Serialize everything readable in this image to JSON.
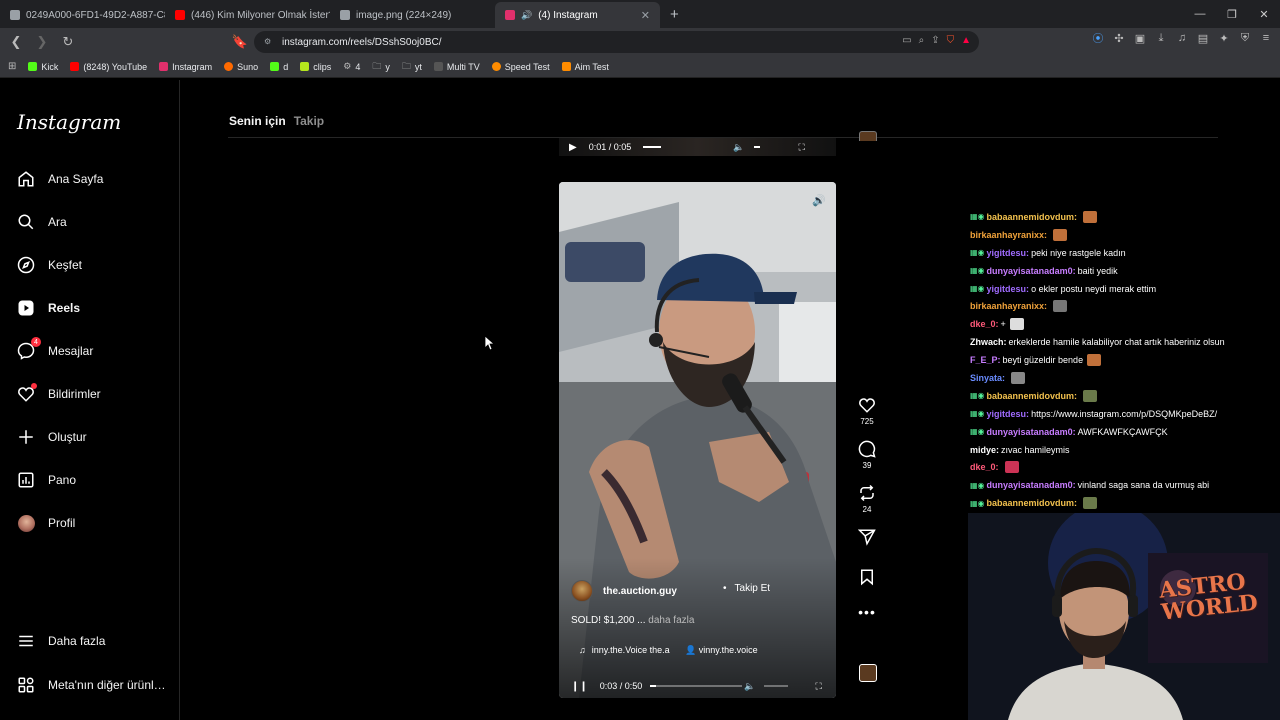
{
  "browser": {
    "tabs": [
      {
        "title": "0249A000-6FD1-49D2-A887-C83D2…",
        "favicon_color": "#9aa0a6",
        "active": false
      },
      {
        "title": "(446) Kim Milyoner Olmak İster? 120…",
        "favicon_color": "#ff0000",
        "active": false
      },
      {
        "title": "image.png (224×249)",
        "favicon_color": "#9aa0a6",
        "active": false
      },
      {
        "title": "(4) Instagram",
        "favicon_color": "#e1306c",
        "active": true
      }
    ],
    "url": "instagram.com/reels/DSshS0oj0BC/",
    "bookmarks": [
      {
        "label": "Kick",
        "color": "#53fc18"
      },
      {
        "label": "(8248) YouTube",
        "color": "#ff0000"
      },
      {
        "label": "Instagram",
        "color": "#e1306c"
      },
      {
        "label": "Suno",
        "color": "#ff6a00"
      },
      {
        "label": "d",
        "color": "#53fc18"
      },
      {
        "label": "clips",
        "color": "#53fc18"
      },
      {
        "label": "4",
        "color": "#9aa0a6"
      },
      {
        "label": "y",
        "color": "#9aa0a6"
      },
      {
        "label": "yt",
        "color": "#9aa0a6"
      },
      {
        "label": "Multi TV",
        "color": "#9aa0a6"
      },
      {
        "label": "Speed Test",
        "color": "#ff8c00"
      },
      {
        "label": "Aim Test",
        "color": "#ff8c00"
      }
    ]
  },
  "instagram": {
    "logo": "Instagram",
    "nav": [
      {
        "label": "Ana Sayfa",
        "icon": "home-icon"
      },
      {
        "label": "Ara",
        "icon": "search-icon"
      },
      {
        "label": "Keşfet",
        "icon": "compass-icon"
      },
      {
        "label": "Reels",
        "icon": "reels-icon"
      },
      {
        "label": "Mesajlar",
        "icon": "messenger-icon",
        "badge": "4"
      },
      {
        "label": "Bildirimler",
        "icon": "heart-icon"
      },
      {
        "label": "Oluştur",
        "icon": "plus-icon"
      },
      {
        "label": "Pano",
        "icon": "dashboard-icon"
      },
      {
        "label": "Profil",
        "icon": "avatar"
      }
    ],
    "more": "Daha fazla",
    "meta": "Meta'nın diğer ürünl…",
    "feed_tabs": {
      "for_you": "Senin için",
      "following": "Takip"
    }
  },
  "prev_reel": {
    "time": "0:01 / 0:05"
  },
  "reel": {
    "username": "the.auction.guy",
    "follow": "Takip Et",
    "caption": "SOLD! $1,200 ...",
    "caption_more": "daha fazla",
    "audio": "inny.the.Voice  the.a",
    "tagged": "vinny.the.voice",
    "time": "0:03 / 0:50",
    "likes": "725",
    "comments": "39",
    "reposts": "24"
  },
  "chat": [
    {
      "user": "babaannemidovdum:",
      "user_color": "#f2c14e",
      "msg": "",
      "emote": "#c0703a",
      "badges": true
    },
    {
      "user": "birkaanhayranixx:",
      "user_color": "#f0a23a",
      "msg": "",
      "emote": "#c0703a",
      "badges": false
    },
    {
      "user": "yigitdesu:",
      "user_color": "#a06cff",
      "msg": "peki niye rastgele kadın",
      "emote": "",
      "badges": true
    },
    {
      "user": "dunyayisatanadam0:",
      "user_color": "#c77dff",
      "msg": "baiti yedik",
      "emote": "",
      "badges": true
    },
    {
      "user": "yigitdesu:",
      "user_color": "#a06cff",
      "msg": "o ekler postu neydi merak ettim",
      "emote": "",
      "badges": true
    },
    {
      "user": "birkaanhayranixx:",
      "user_color": "#f0a23a",
      "msg": "",
      "emote": "#777777",
      "badges": false
    },
    {
      "user": "dke_0:",
      "user_color": "#ff5a7a",
      "msg": "+ ",
      "emote": "#dddddd",
      "badges": false
    },
    {
      "user": "Zhwach:",
      "user_color": "#ffffff",
      "msg": "erkeklerde hamile kalabiliyor chat artık haberiniz olsun",
      "emote": "",
      "badges": false
    },
    {
      "user": "F_E_P:",
      "user_color": "#c77dff",
      "msg": "beyti güzeldir bende",
      "emote": "#c0703a",
      "badges": false
    },
    {
      "user": "Sinyata:",
      "user_color": "#6a8cff",
      "msg": "",
      "emote": "#888888",
      "badges": false
    },
    {
      "user": "babaannemidovdum:",
      "user_color": "#f2c14e",
      "msg": "",
      "emote": "#6a7a4a",
      "badges": true
    },
    {
      "user": "yigitdesu:",
      "user_color": "#a06cff",
      "msg": "https://www.instagram.com/p/DSQMKpeDeBZ/",
      "emote": "",
      "badges": true
    },
    {
      "user": "dunyayisatanadam0:",
      "user_color": "#c77dff",
      "msg": "AWFKAWFKÇAWFÇK",
      "emote": "",
      "badges": true
    },
    {
      "user": "midye:",
      "user_color": "#ffffff",
      "msg": "zıvac hamileymis",
      "emote": "",
      "badges": false
    },
    {
      "user": "dke_0:",
      "user_color": "#ff5a7a",
      "msg": "",
      "emote": "#cc3355",
      "badges": false
    },
    {
      "user": "dunyayisatanadam0:",
      "user_color": "#c77dff",
      "msg": "vinland saga sana da vurmuş abi",
      "emote": "",
      "badges": true
    },
    {
      "user": "babaannemidovdum:",
      "user_color": "#f2c14e",
      "msg": "",
      "emote": "#6a7a4a",
      "badges": true
    }
  ],
  "webcam": {
    "poster_text": "ASTRO WORLD"
  }
}
